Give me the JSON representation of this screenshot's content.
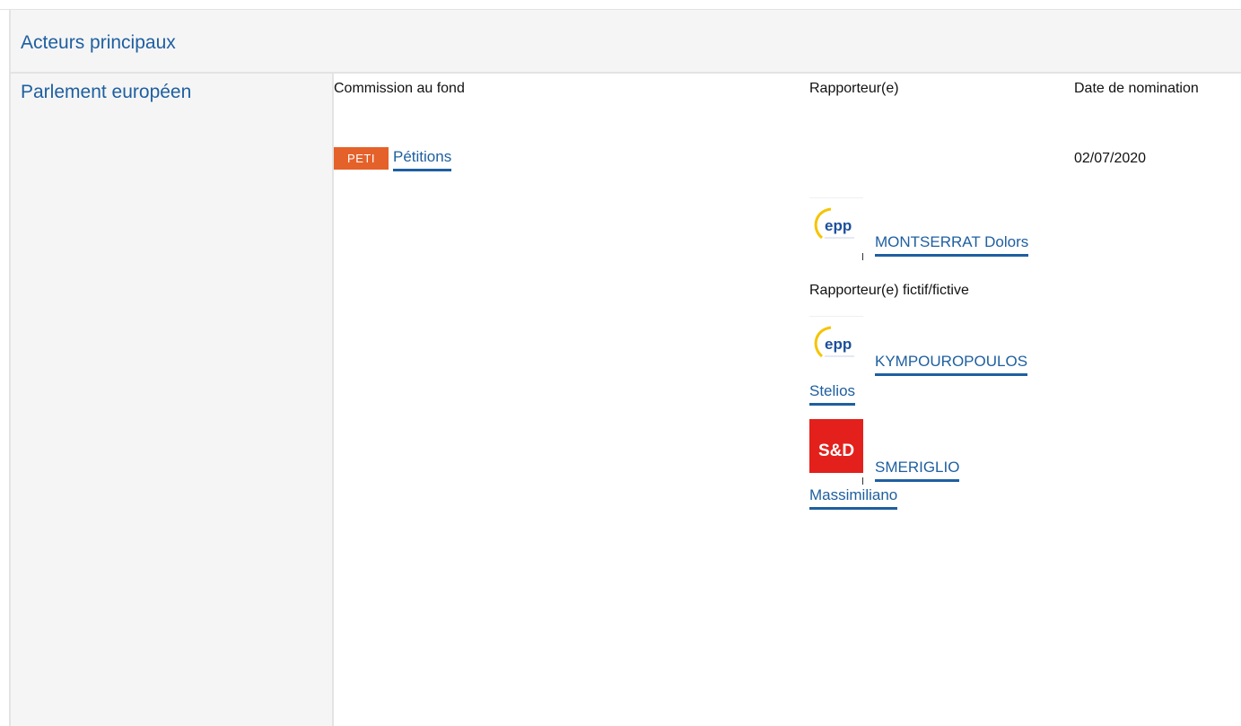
{
  "section": {
    "title": "Acteurs principaux"
  },
  "institution": {
    "name": "Parlement européen"
  },
  "columns": {
    "committee": "Commission au fond",
    "rapporteur": "Rapporteur(e)",
    "date": "Date de nomination"
  },
  "committee": {
    "code": "PETI",
    "name": "Pétitions",
    "badge_color": "#e5612a"
  },
  "appointment_date": "02/07/2020",
  "rapporteur": {
    "group_logo": "epp-logo",
    "name": "MONTSERRAT Dolors"
  },
  "shadow": {
    "label": "Rapporteur(e) fictif/fictive",
    "members": [
      {
        "group_logo": "epp-logo",
        "name_line1": "KYMPOUROPOULOS",
        "name_line2": "Stelios"
      },
      {
        "group_logo": "sd-logo",
        "name_line1": "SMERIGLIO",
        "name_line2": "Massimiliano"
      }
    ]
  },
  "logos": {
    "epp_text": "epp",
    "sd_text": "S&D",
    "epp_arc_color": "#f5c400",
    "epp_text_color": "#1b4f9c",
    "sd_color": "#e3201b"
  },
  "colors": {
    "link": "#1e5fa0",
    "header_bg": "#f5f5f5"
  }
}
